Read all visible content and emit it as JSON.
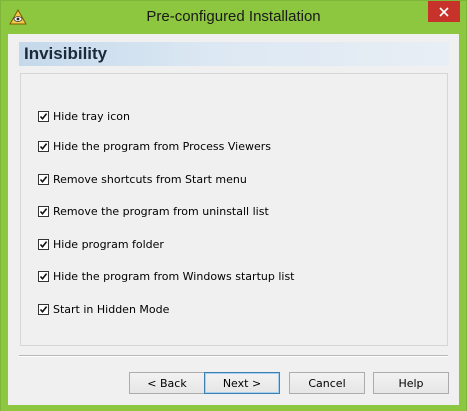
{
  "window": {
    "title": "Pre-configured Installation",
    "accent_color": "#8dc63f",
    "close_color": "#c7322b",
    "app_icon": "eye-pyramid-icon"
  },
  "section": {
    "title": "Invisibility"
  },
  "options": [
    {
      "label": "Hide tray icon",
      "checked": true
    },
    {
      "label": "Hide the program from Process Viewers",
      "checked": true
    },
    {
      "label": "Remove shortcuts from Start menu",
      "checked": true
    },
    {
      "label": "Remove the program from uninstall list",
      "checked": true
    },
    {
      "label": "Hide program folder",
      "checked": true
    },
    {
      "label": "Hide the program from Windows startup list",
      "checked": true
    },
    {
      "label": "Start in Hidden Mode",
      "checked": true
    }
  ],
  "buttons": {
    "back": "< Back",
    "next": "Next >",
    "cancel": "Cancel",
    "help": "Help"
  }
}
